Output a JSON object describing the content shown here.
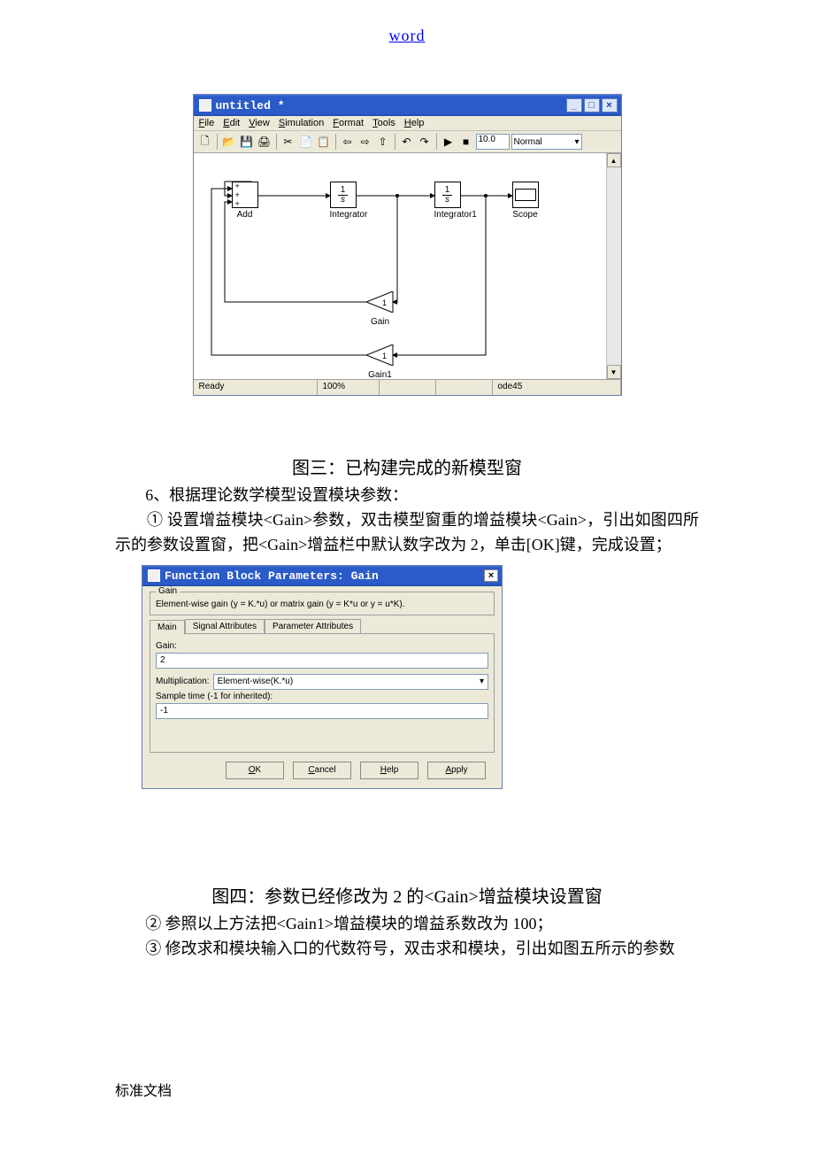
{
  "header_link": "word",
  "sim": {
    "title": "untitled *",
    "menus": [
      "File",
      "Edit",
      "View",
      "Simulation",
      "Format",
      "Tools",
      "Help"
    ],
    "stop_time": "10.0",
    "mode": "Normal",
    "blocks": {
      "add": "Add",
      "integrator": "Integrator",
      "integrator1": "Integrator1",
      "scope": "Scope",
      "gain": "Gain",
      "gain1": "Gain1",
      "frac_num": "1",
      "frac_den": "s",
      "gain_val": "1",
      "gain1_val": "1"
    },
    "status": {
      "ready": "Ready",
      "zoom": "100%",
      "solver": "ode45"
    }
  },
  "caption3": "图三：已构建完成的新模型窗",
  "para6": "6、根据理论数学模型设置模块参数：",
  "para_circle1": "① 设置增益模块<Gain>参数，双击模型窗重的增益模块<Gain>，引出如图四所示的参数设置窗，把<Gain>增益栏中默认数字改为 2，单击[OK]键，完成设置；",
  "dialog": {
    "title": "Function Block Parameters: Gain",
    "group_title": "Gain",
    "desc": "Element-wise gain (y = K.*u) or matrix gain (y = K*u or y = u*K).",
    "tabs": [
      "Main",
      "Signal Attributes",
      "Parameter Attributes"
    ],
    "gain_label": "Gain:",
    "gain_value": "2",
    "mult_label": "Multiplication:",
    "mult_value": "Element-wise(K.*u)",
    "sample_label": "Sample time (-1 for inherited):",
    "sample_value": "-1",
    "buttons": {
      "ok": "OK",
      "cancel": "Cancel",
      "help": "Help",
      "apply": "Apply"
    }
  },
  "caption4": "图四：参数已经修改为 2 的<Gain>增益模块设置窗",
  "para_circle2": "② 参照以上方法把<Gain1>增益模块的增益系数改为 100；",
  "para_circle3": "③ 修改求和模块输入口的代数符号，双击求和模块，引出如图五所示的参数",
  "footer": "标准文档"
}
